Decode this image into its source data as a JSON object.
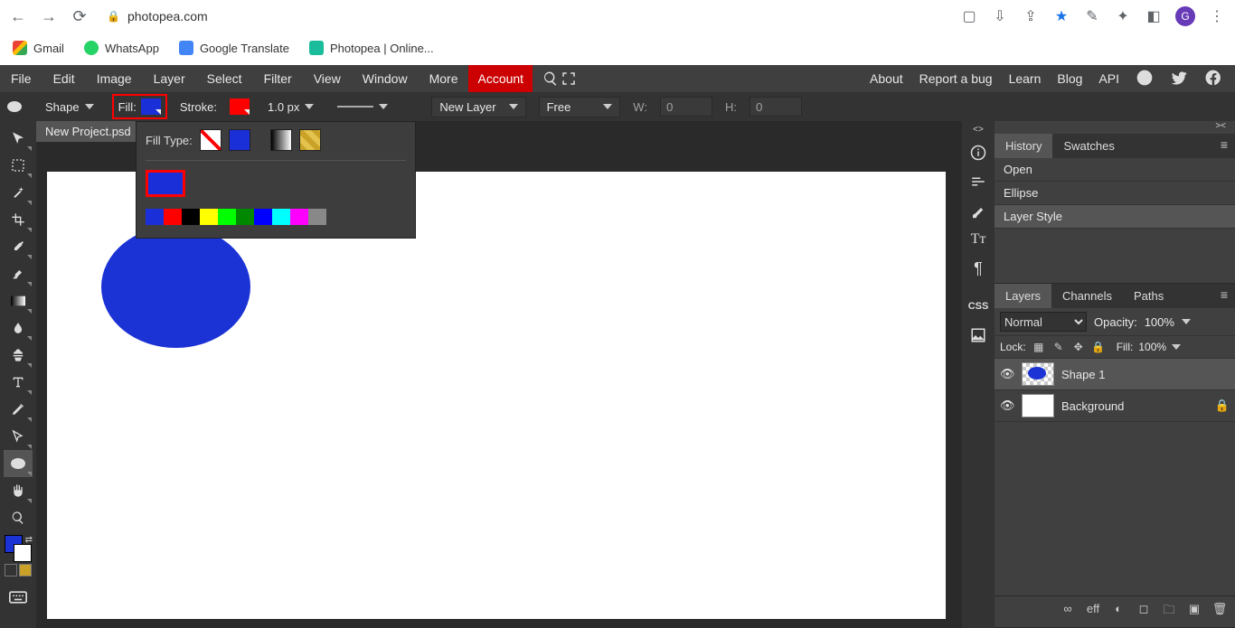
{
  "browser": {
    "url": "photopea.com",
    "profile_initial": "G",
    "bookmarks": [
      {
        "label": "Gmail"
      },
      {
        "label": "WhatsApp"
      },
      {
        "label": "Google Translate"
      },
      {
        "label": "Photopea | Online..."
      }
    ]
  },
  "menu": {
    "items": [
      "File",
      "Edit",
      "Image",
      "Layer",
      "Select",
      "Filter",
      "View",
      "Window",
      "More"
    ],
    "account": "Account",
    "right": [
      "About",
      "Report a bug",
      "Learn",
      "Blog",
      "API"
    ]
  },
  "options": {
    "mode": "Shape",
    "fill_label": "Fill:",
    "fill_color": "#1a2fd8",
    "stroke_label": "Stroke:",
    "stroke_color": "#ff0000",
    "stroke_width": "1.0 px",
    "layer_mode": "New Layer",
    "constrain": "Free",
    "w_label": "W:",
    "w_value": "0",
    "h_label": "H:",
    "h_value": "0"
  },
  "doc": {
    "tab": "New Project.psd"
  },
  "fill_popover": {
    "label": "Fill Type:",
    "current": "#1a2fd8",
    "palette": [
      "#1a2fd8",
      "#ff0000",
      "#000000",
      "#ffff00",
      "#00ff00",
      "#008800",
      "#0000ff",
      "#00ffff",
      "#ff00ff",
      "#888888"
    ]
  },
  "history": {
    "tabs": [
      "History",
      "Swatches"
    ],
    "items": [
      "Open",
      "Ellipse",
      "Layer Style"
    ]
  },
  "layers": {
    "tabs": [
      "Layers",
      "Channels",
      "Paths"
    ],
    "blend": "Normal",
    "opacity_label": "Opacity:",
    "opacity": "100%",
    "lock_label": "Lock:",
    "fill_label": "Fill:",
    "fill": "100%",
    "items": [
      {
        "name": "Shape 1",
        "selected": true,
        "is_shape": true,
        "locked": false
      },
      {
        "name": "Background",
        "selected": false,
        "is_shape": false,
        "locked": true
      }
    ],
    "footer_eff": "eff"
  }
}
